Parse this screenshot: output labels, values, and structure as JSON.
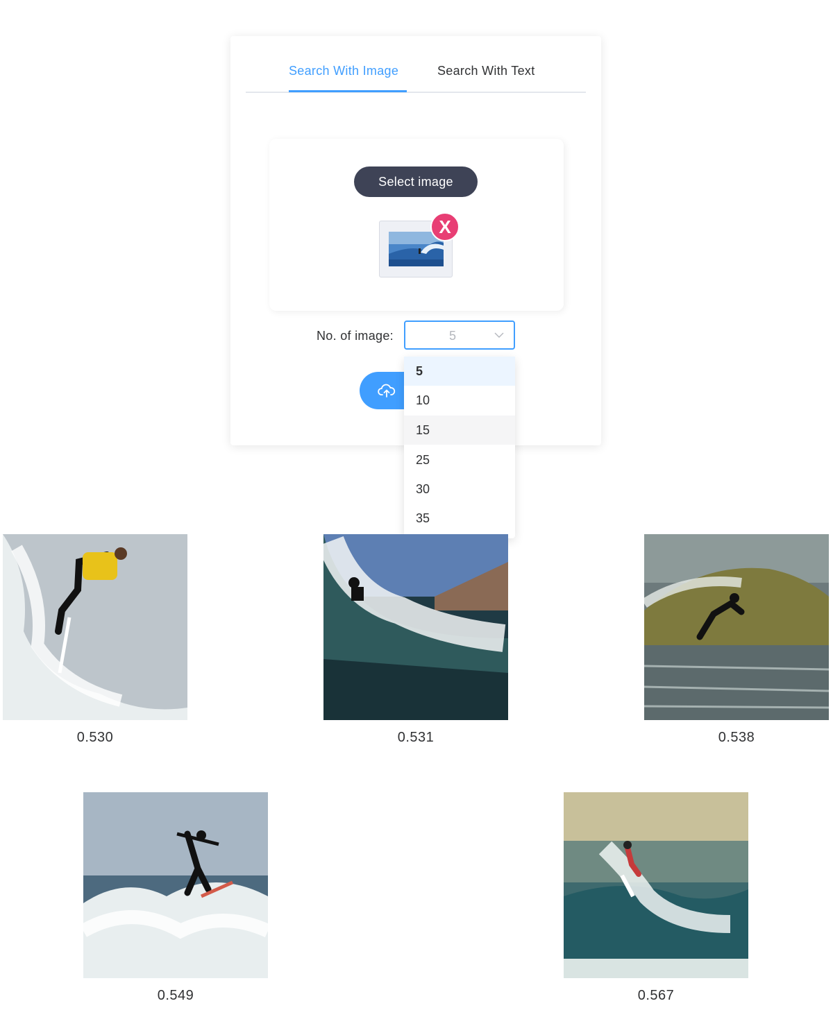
{
  "tabs": [
    {
      "label": "Search With Image",
      "active": true
    },
    {
      "label": "Search With Text",
      "active": false
    }
  ],
  "upload": {
    "select_button_label": "Select image",
    "remove_icon_label": "X"
  },
  "count": {
    "label": "No. of image:",
    "value": "5",
    "options": [
      "5",
      "10",
      "15",
      "25",
      "30",
      "35"
    ],
    "selected": "5",
    "hovered": "15"
  },
  "results": [
    {
      "score": "0.530"
    },
    {
      "score": "0.531"
    },
    {
      "score": "0.538"
    },
    {
      "score": "0.549"
    },
    {
      "score": "0.567"
    }
  ],
  "colors": {
    "accent": "#409eff",
    "dark_button": "#3e4356",
    "remove": "#e83e74"
  },
  "icons": {
    "upload": "cloud-upload-icon",
    "select_arrow": "chevron-down-icon",
    "remove": "close-icon"
  }
}
